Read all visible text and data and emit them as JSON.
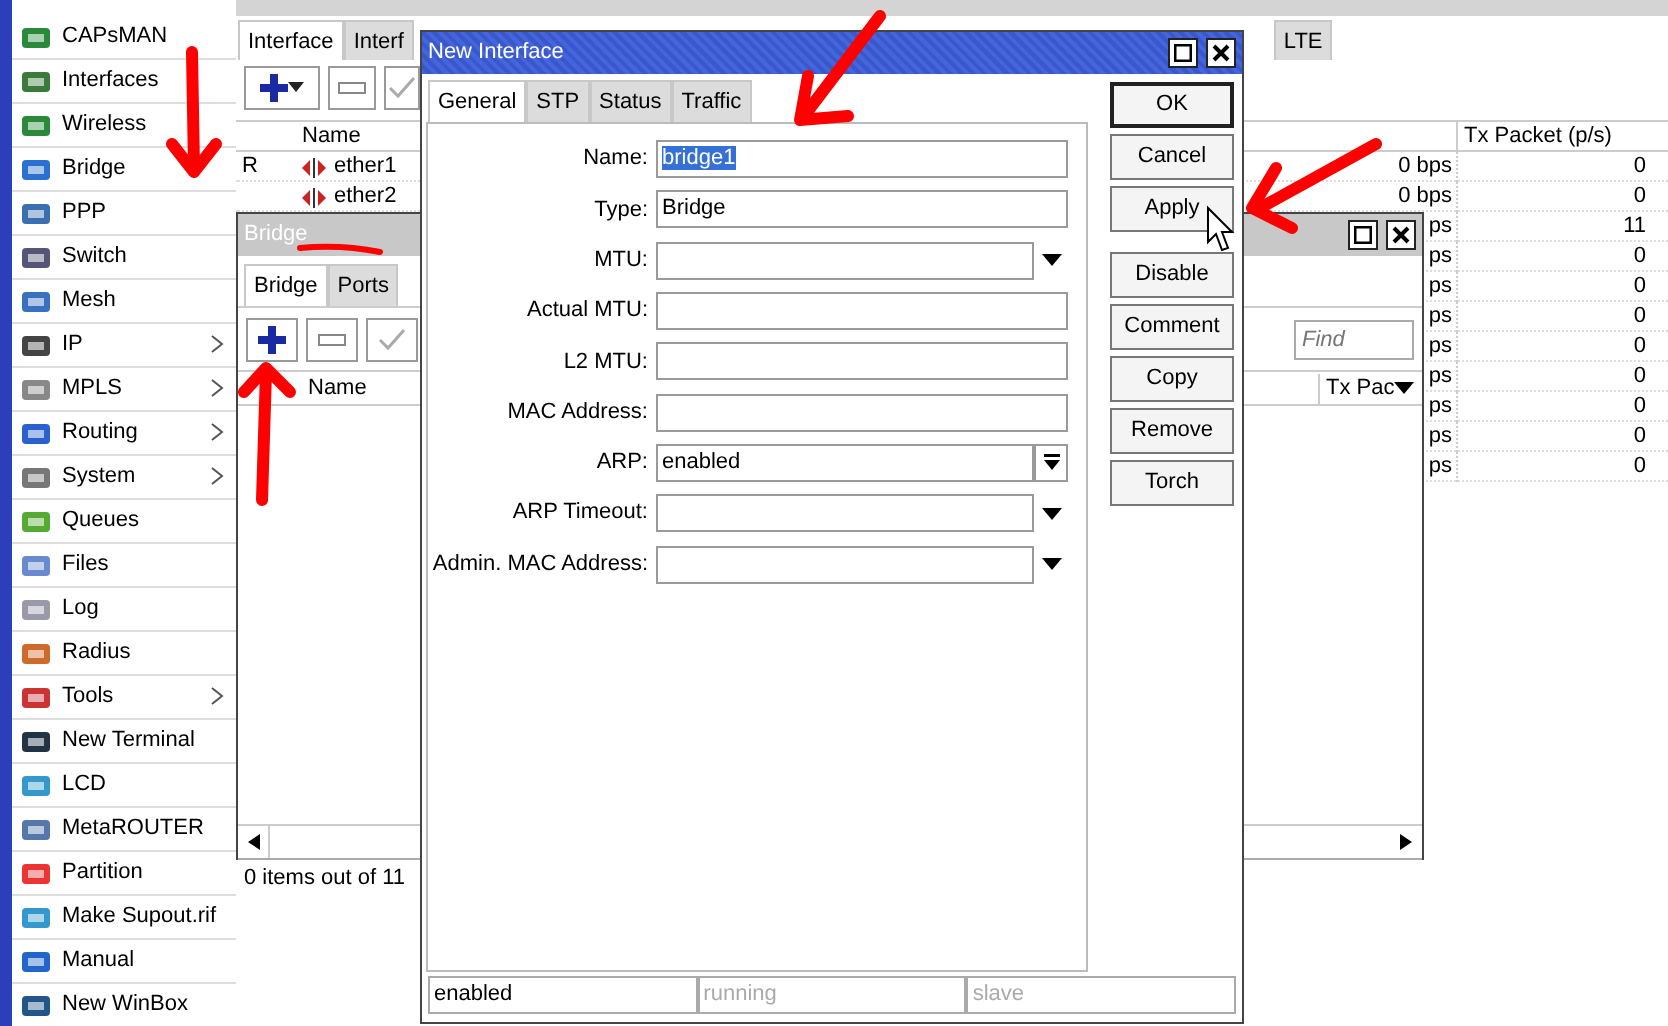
{
  "sidebar": {
    "items": [
      {
        "label": "CAPsMAN",
        "submenu": false
      },
      {
        "label": "Interfaces",
        "submenu": false
      },
      {
        "label": "Wireless",
        "submenu": false
      },
      {
        "label": "Bridge",
        "submenu": false
      },
      {
        "label": "PPP",
        "submenu": false
      },
      {
        "label": "Switch",
        "submenu": false
      },
      {
        "label": "Mesh",
        "submenu": false
      },
      {
        "label": "IP",
        "submenu": true
      },
      {
        "label": "MPLS",
        "submenu": true
      },
      {
        "label": "Routing",
        "submenu": true
      },
      {
        "label": "System",
        "submenu": true
      },
      {
        "label": "Queues",
        "submenu": false
      },
      {
        "label": "Files",
        "submenu": false
      },
      {
        "label": "Log",
        "submenu": false
      },
      {
        "label": "Radius",
        "submenu": false
      },
      {
        "label": "Tools",
        "submenu": true
      },
      {
        "label": "New Terminal",
        "submenu": false
      },
      {
        "label": "LCD",
        "submenu": false
      },
      {
        "label": "MetaROUTER",
        "submenu": false
      },
      {
        "label": "Partition",
        "submenu": false
      },
      {
        "label": "Make Supout.rif",
        "submenu": false
      },
      {
        "label": "Manual",
        "submenu": false
      },
      {
        "label": "New WinBox",
        "submenu": false
      }
    ]
  },
  "interface_window": {
    "tabs": [
      {
        "label": "Interface",
        "selected": true
      },
      {
        "label": "Interf",
        "selected": false
      }
    ],
    "tabs_right": [
      {
        "label": "LTE",
        "selected": false
      }
    ],
    "table": {
      "columns": [
        "Name",
        "Tx Packet (p/s)"
      ],
      "rows": [
        {
          "flag": "R",
          "name": "ether1",
          "rx": "0 bps",
          "tx": "0"
        },
        {
          "flag": "",
          "name": "ether2",
          "rx": "0 bps",
          "tx": "0"
        },
        {
          "flag": "",
          "name": "",
          "rx": "ps",
          "tx": "11"
        },
        {
          "flag": "",
          "name": "",
          "rx": "ps",
          "tx": "0"
        },
        {
          "flag": "",
          "name": "",
          "rx": "ps",
          "tx": "0"
        },
        {
          "flag": "",
          "name": "",
          "rx": "ps",
          "tx": "0"
        },
        {
          "flag": "",
          "name": "",
          "rx": "ps",
          "tx": "0"
        },
        {
          "flag": "",
          "name": "",
          "rx": "ps",
          "tx": "0"
        },
        {
          "flag": "",
          "name": "",
          "rx": "ps",
          "tx": "0"
        },
        {
          "flag": "",
          "name": "",
          "rx": "ps",
          "tx": "0"
        },
        {
          "flag": "",
          "name": "",
          "rx": "ps",
          "tx": "0"
        }
      ]
    }
  },
  "bridge_window": {
    "title": "Bridge",
    "tabs": [
      {
        "label": "Bridge",
        "selected": true
      },
      {
        "label": "Ports",
        "selected": false
      }
    ],
    "find": {
      "placeholder": "Find"
    },
    "columns": [
      "Name",
      "Tx Pac"
    ],
    "status": "0 items out of 11"
  },
  "new_interface": {
    "title": "New Interface",
    "tabs": [
      {
        "label": "General",
        "selected": true
      },
      {
        "label": "STP",
        "selected": false
      },
      {
        "label": "Status",
        "selected": false
      },
      {
        "label": "Traffic",
        "selected": false
      }
    ],
    "fields": [
      {
        "label": "Name:",
        "kind": "text",
        "value": "bridge1",
        "highlighted": true
      },
      {
        "label": "Type:",
        "kind": "text",
        "value": "Bridge",
        "highlighted": false
      },
      {
        "label": "MTU:",
        "kind": "combo"
      },
      {
        "label": "Actual MTU:",
        "kind": "text"
      },
      {
        "label": "L2 MTU:",
        "kind": "text"
      },
      {
        "label": "MAC Address:",
        "kind": "text"
      },
      {
        "label": "ARP:",
        "kind": "select",
        "value": "enabled",
        "highlighted": false
      },
      {
        "label": "ARP Timeout:",
        "kind": "combo"
      },
      {
        "label": "Admin. MAC Address:",
        "kind": "combo"
      }
    ],
    "buttons": [
      {
        "label": "OK",
        "default": true
      },
      {
        "label": "Cancel",
        "default": false
      },
      {
        "label": "Apply",
        "default": false
      },
      {
        "label": "Disable",
        "default": false
      },
      {
        "label": "Comment",
        "default": false
      },
      {
        "label": "Copy",
        "default": false
      },
      {
        "label": "Remove",
        "default": false
      },
      {
        "label": "Torch",
        "default": false
      }
    ],
    "status_bar": [
      {
        "text": "enabled",
        "disabled": false
      },
      {
        "text": "running",
        "disabled": true
      },
      {
        "text": "slave",
        "disabled": true
      }
    ]
  }
}
